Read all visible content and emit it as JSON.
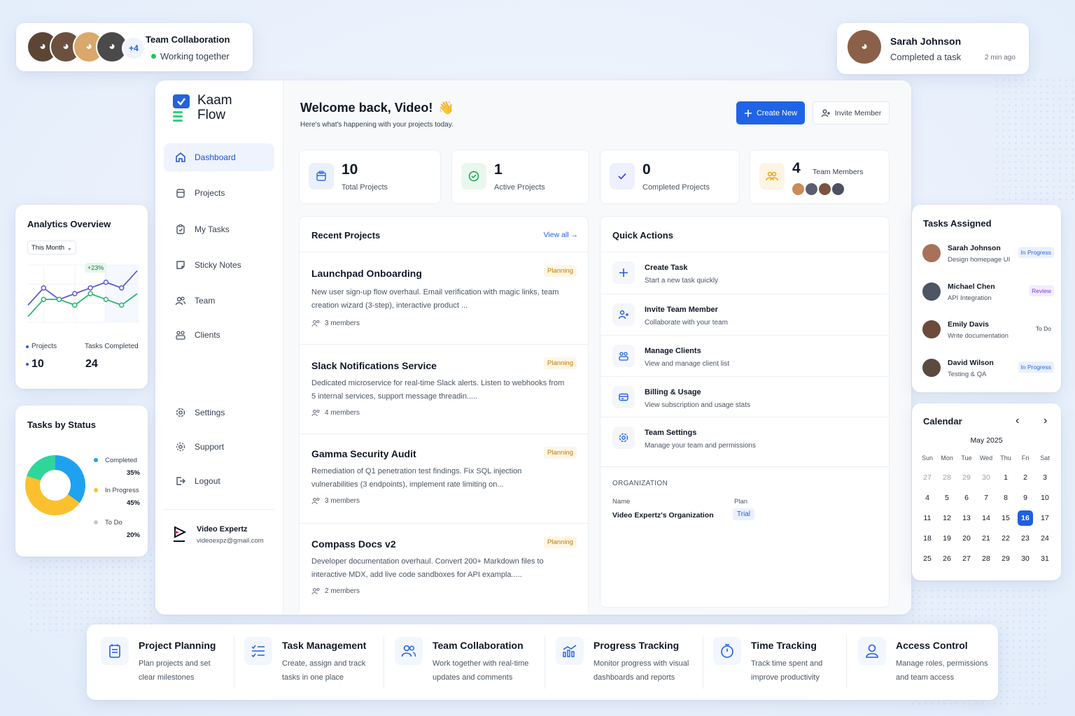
{
  "team_card": {
    "title": "Team Collaboration",
    "status": "Working together",
    "extra_count": "+4"
  },
  "activity_card": {
    "name": "Sarah Johnson",
    "action": "Completed a task",
    "time": "2 min ago"
  },
  "brand": {
    "line1": "Kaam",
    "line2": "Flow"
  },
  "sidebar": {
    "items": [
      {
        "label": "Dashboard",
        "icon": "home-icon"
      },
      {
        "label": "Projects",
        "icon": "folder-icon"
      },
      {
        "label": "My Tasks",
        "icon": "clipboard-check-icon"
      },
      {
        "label": "Sticky Notes",
        "icon": "sticky-note-icon"
      },
      {
        "label": "Team",
        "icon": "users-icon"
      },
      {
        "label": "Clients",
        "icon": "clients-icon"
      }
    ],
    "bottom": [
      {
        "label": "Settings",
        "icon": "gear-icon"
      },
      {
        "label": "Support",
        "icon": "support-gear-icon"
      },
      {
        "label": "Logout",
        "icon": "logout-icon"
      }
    ],
    "user": {
      "name": "Video Expertz",
      "email": "videoexpz@gmail.com"
    }
  },
  "header": {
    "welcome": "Welcome back, Video!",
    "emoji": "👋",
    "subtitle": "Here's what's happening with your projects today.",
    "create_label": "Create New",
    "invite_label": "Invite Member"
  },
  "stats": [
    {
      "value": "10",
      "label": "Total Projects",
      "icon": "box-icon",
      "color": "#2f6fe4"
    },
    {
      "value": "1",
      "label": "Active Projects",
      "icon": "check-circle-icon",
      "color": "#16a34a"
    },
    {
      "value": "0",
      "label": "Completed Projects",
      "icon": "check-icon",
      "color": "#4f46e5"
    },
    {
      "value": "4",
      "label": "Team Members",
      "icon": "team-icon",
      "color": "#f59e0b"
    }
  ],
  "recent_projects": {
    "title": "Recent Projects",
    "view_all": "View all →",
    "items": [
      {
        "name": "Launchpad Onboarding",
        "status": "Planning",
        "desc": "New user sign-up flow overhaul. Email verification with magic links, team creation wizard (3-step), interactive product ...",
        "members": "3 members"
      },
      {
        "name": "Slack Notifications Service",
        "status": "Planning",
        "desc": "Dedicated microservice for real-time Slack alerts. Listen to webhooks from 5 internal services, support message threadin.....",
        "members": "4 members"
      },
      {
        "name": "Gamma Security Audit",
        "status": "Planning",
        "desc": "Remediation of Q1 penetration test findings. Fix SQL injection vulnerabilities (3 endpoints), implement rate limiting on...",
        "members": "3 members"
      },
      {
        "name": "Compass Docs v2",
        "status": "Planning",
        "desc": "Developer documentation overhaul. Convert 200+ Markdown files to interactive MDX, add live code sandboxes for API exampla.....",
        "members": "2 members"
      }
    ]
  },
  "quick_actions": {
    "title": "Quick Actions",
    "items": [
      {
        "title": "Create Task",
        "sub": "Start a new task quickly",
        "icon": "plus-icon"
      },
      {
        "title": "Invite Team Member",
        "sub": "Collaborate with your team",
        "icon": "user-plus-icon"
      },
      {
        "title": "Manage Clients",
        "sub": "View and manage client list",
        "icon": "clients-icon"
      },
      {
        "title": "Billing & Usage",
        "sub": "View subscription and usage stats",
        "icon": "billing-icon"
      },
      {
        "title": "Team Settings",
        "sub": "Manage your team and permissions",
        "icon": "settings-icon"
      }
    ],
    "org": {
      "heading": "ORGANIZATION",
      "name_label": "Name",
      "name": "Video Expertz's Organization",
      "plan_label": "Plan",
      "plan": "Trial"
    }
  },
  "analytics": {
    "title": "Analytics Overview",
    "period": "This Month",
    "delta": "+23%",
    "legend_projects": "Projects",
    "legend_tasks": "Tasks Completed",
    "projects_value": "10",
    "tasks_value": "24",
    "chart_data": {
      "type": "line",
      "series": [
        {
          "name": "Projects",
          "values": [
            3,
            6,
            4,
            5,
            6,
            7,
            6,
            9
          ],
          "color": "#5b5bd6"
        },
        {
          "name": "Tasks Completed",
          "values": [
            1,
            4,
            4,
            3,
            5,
            4,
            3,
            5
          ],
          "color": "#2bb673"
        }
      ],
      "ylim": [
        0,
        10
      ],
      "grid": true
    }
  },
  "tasks_status": {
    "title": "Tasks by Status",
    "chart_data": {
      "type": "pie",
      "categories": [
        "Completed",
        "In Progress",
        "To Do"
      ],
      "values": [
        35,
        45,
        20
      ],
      "colors": [
        "#1ea2f0",
        "#fbc02d",
        "#2fd69a"
      ]
    },
    "legend": [
      {
        "label": "Completed",
        "value": "35%",
        "color": "#1ea2f0"
      },
      {
        "label": "In Progress",
        "value": "45%",
        "color": "#fbc02d"
      },
      {
        "label": "To Do",
        "value": "20%",
        "color": "#c4c9d2"
      }
    ]
  },
  "tasks_assigned": {
    "title": "Tasks Assigned",
    "items": [
      {
        "name": "Sarah Johnson",
        "task": "Design homepage UI",
        "status": "In Progress",
        "fg": "#2563eb",
        "bg": "#eaf1fe"
      },
      {
        "name": "Michael Chen",
        "task": "API Integration",
        "status": "Review",
        "fg": "#7c3aed",
        "bg": "#f3edfe"
      },
      {
        "name": "Emily Davis",
        "task": "Write documentation",
        "status": "To Do",
        "fg": "#374151",
        "bg": "#ffffff"
      },
      {
        "name": "David Wilson",
        "task": "Testing & QA",
        "status": "In Progress",
        "fg": "#2563eb",
        "bg": "#eaf1fe"
      }
    ]
  },
  "calendar": {
    "title": "Calendar",
    "month": "May 2025",
    "days": [
      "Sun",
      "Mon",
      "Tue",
      "Wed",
      "Thu",
      "Fri",
      "Sat"
    ],
    "weeks": [
      [
        "27",
        "28",
        "29",
        "30",
        "1",
        "2",
        "3"
      ],
      [
        "4",
        "5",
        "6",
        "7",
        "8",
        "9",
        "10"
      ],
      [
        "11",
        "12",
        "13",
        "14",
        "15",
        "16",
        "17"
      ],
      [
        "18",
        "19",
        "20",
        "21",
        "22",
        "23",
        "24"
      ],
      [
        "25",
        "26",
        "27",
        "28",
        "29",
        "30",
        "31"
      ]
    ],
    "today": "16"
  },
  "features": [
    {
      "title": "Project Planning",
      "sub": "Plan projects and set clear milestones",
      "icon": "planning-icon"
    },
    {
      "title": "Task Management",
      "sub": "Create, assign and track tasks in one place",
      "icon": "task-list-icon"
    },
    {
      "title": "Team Collaboration",
      "sub": "Work together with real-time updates and comments",
      "icon": "users-icon"
    },
    {
      "title": "Progress Tracking",
      "sub": "Monitor progress with visual dashboards and reports",
      "icon": "chart-icon"
    },
    {
      "title": "Time Tracking",
      "sub": "Track time spent and improve productivity",
      "icon": "timer-icon"
    },
    {
      "title": "Access Control",
      "sub": "Manage roles, permissions and team access",
      "icon": "user-icon"
    }
  ]
}
